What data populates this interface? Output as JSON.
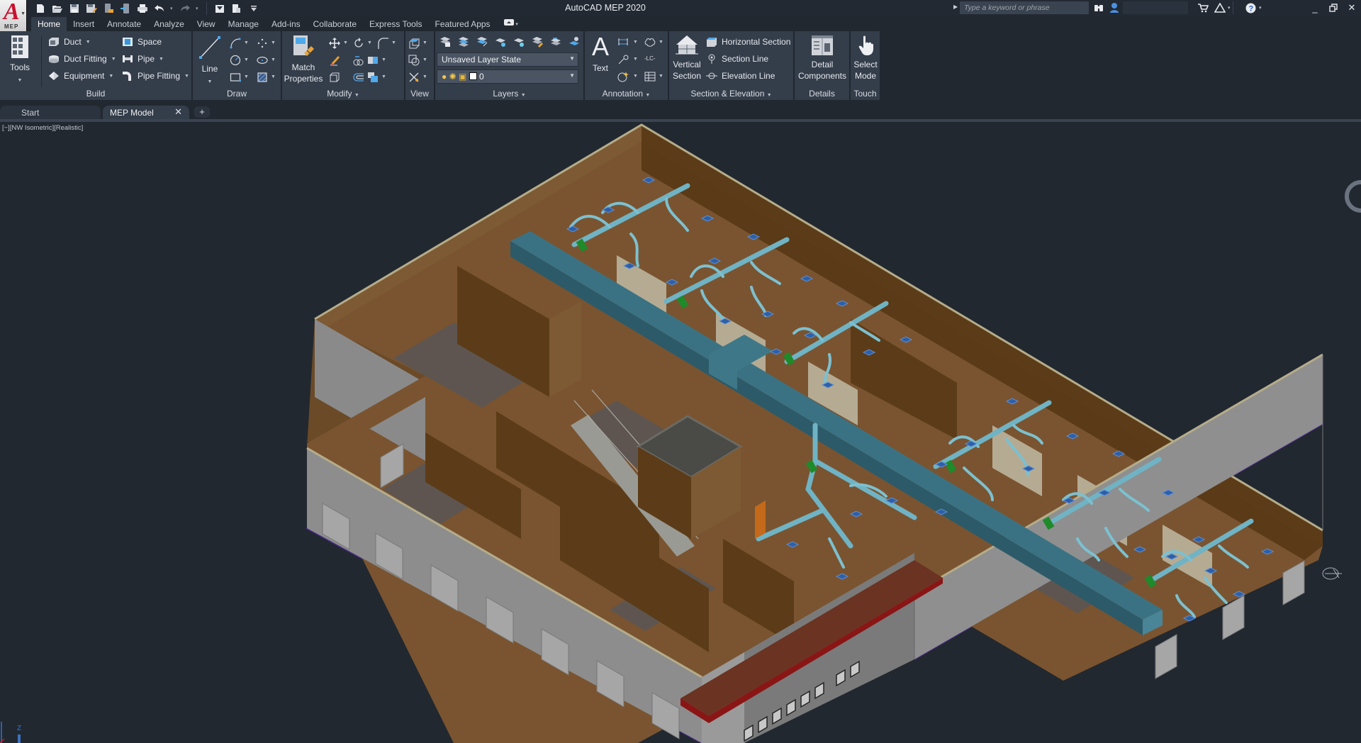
{
  "app": {
    "title": "AutoCAD MEP 2020",
    "badge": "MEP",
    "accent_color": "#c8102e"
  },
  "quick_access": {
    "items": [
      "new-icon",
      "open-icon",
      "save-icon",
      "save-as-icon",
      "open-from-mobile-icon",
      "save-to-mobile-icon",
      "plot-icon",
      "undo-icon",
      "redo-icon",
      "share-view-icon",
      "workspace-icon",
      "customize-qat-icon"
    ]
  },
  "search": {
    "placeholder": "Type a keyword or phrase"
  },
  "ribbon_tabs": [
    "Home",
    "Insert",
    "Annotate",
    "Analyze",
    "View",
    "Manage",
    "Add-ins",
    "Collaborate",
    "Express Tools",
    "Featured Apps"
  ],
  "active_tab": "Home",
  "panels": {
    "tools": {
      "label": "Tools"
    },
    "build": {
      "label": "Build",
      "items": [
        "Duct",
        "Duct Fitting",
        "Equipment",
        "Space",
        "Pipe",
        "Pipe Fitting"
      ]
    },
    "draw": {
      "label": "Draw",
      "line": "Line"
    },
    "modify": {
      "label": "Modify",
      "match_properties": "Match Properties",
      "match_line1": "Match",
      "match_line2": "Properties"
    },
    "view": {
      "label": "View"
    },
    "layers": {
      "label": "Layers",
      "layer_state": "Unsaved Layer State",
      "current_layer": "0"
    },
    "annotation": {
      "label": "Annotation",
      "text": "Text",
      "lc": "-LC-"
    },
    "section": {
      "label": "Section & Elevation",
      "vertical_line1": "Vertical",
      "vertical_line2": "Section",
      "items": [
        "Horizontal Section",
        "Section Line",
        "Elevation Line"
      ]
    },
    "details": {
      "label": "Details",
      "line1": "Detail",
      "line2": "Components"
    },
    "touch": {
      "label": "Touch",
      "line1": "Select",
      "line2": "Mode"
    }
  },
  "doc_tabs": [
    {
      "label": "Start",
      "active": false
    },
    {
      "label": "MEP Model",
      "active": true
    }
  ],
  "viewport": {
    "label": "[−][NW Isometric][Realistic]"
  },
  "colors": {
    "background": "#212830",
    "ribbon_panel": "#343d4a",
    "duct": "#3b7283",
    "pipe": "#6fb3c4",
    "diffuser": "#2e5fa8",
    "damper": "#1f8a2a",
    "wall_interior": "#7a5430",
    "exterior_wall": "#8d8d8d",
    "canopy": "#6b3322"
  }
}
